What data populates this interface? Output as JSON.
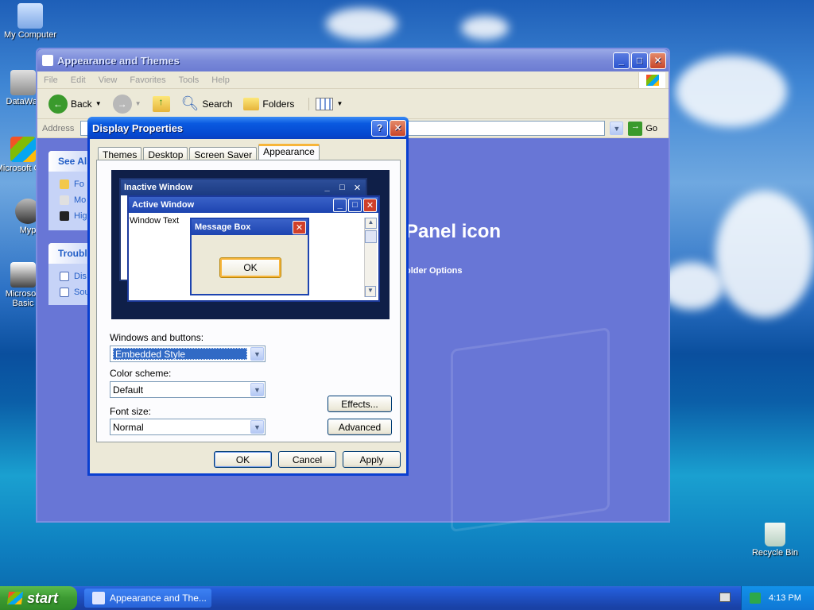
{
  "desktop": {
    "icons": [
      {
        "label": "My Computer"
      },
      {
        "label": "DataWar"
      },
      {
        "label": "Microsoft C++"
      },
      {
        "label": "Myp"
      },
      {
        "label": "Microsoft Basic"
      },
      {
        "label": "Recycle Bin"
      }
    ]
  },
  "explorer": {
    "title": "Appearance and Themes",
    "menu": [
      "File",
      "Edit",
      "View",
      "Favorites",
      "Tools",
      "Help"
    ],
    "toolbar": {
      "back": "Back",
      "search": "Search",
      "folders": "Folders"
    },
    "address_label": "Address",
    "go_label": "Go",
    "see_also": {
      "title": "See Als",
      "items": [
        "Fo",
        "Mo",
        "Hig"
      ]
    },
    "troubleshooters": {
      "title": "Troubl",
      "items": [
        "Dis",
        "Sou"
      ]
    },
    "heading": "Panel icon",
    "link": "older Options"
  },
  "dialog": {
    "title": "Display Properties",
    "tabs": [
      "Themes",
      "Desktop",
      "Screen Saver",
      "Appearance"
    ],
    "active_tab": "Appearance",
    "preview": {
      "inactive_title": "Inactive Window",
      "active_title": "Active Window",
      "window_text": "Window Text",
      "message_title": "Message Box",
      "ok": "OK"
    },
    "windows_buttons_label": "Windows and buttons:",
    "windows_buttons_value": "Embedded Style",
    "color_scheme_label": "Color scheme:",
    "color_scheme_value": "Default",
    "font_size_label": "Font size:",
    "font_size_value": "Normal",
    "effects": "Effects...",
    "advanced": "Advanced",
    "ok": "OK",
    "cancel": "Cancel",
    "apply": "Apply"
  },
  "taskbar": {
    "start": "start",
    "task_button": "Appearance and The...",
    "clock": "4:13 PM"
  },
  "colors": {
    "xp_blue_title": "#0548d0",
    "start_green": "#3c9a32",
    "selection": "#316ac5"
  }
}
